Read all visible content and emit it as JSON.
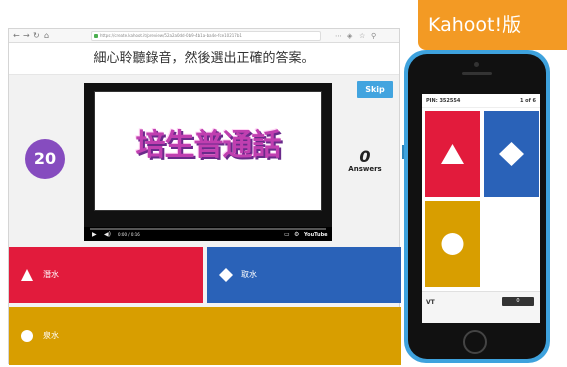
{
  "brand": {
    "label": "Kahoot!版"
  },
  "browser": {
    "url": "https://create.kahoot.it/preview/52a2a0dd-0b9-4b1a-ba4e-fce10217b1"
  },
  "question": {
    "text": "細心聆聽錄音，然後選出正確的答案。"
  },
  "controls": {
    "skip_label": "Skip",
    "timer": "20",
    "answers_count": "0",
    "answers_label": "Answers"
  },
  "video": {
    "title": "培生普通話",
    "time": "0:00 / 0:16",
    "provider": "YouTube"
  },
  "answers": [
    {
      "shape": "triangle-icon",
      "label": "潛水",
      "color": "#e21b3c"
    },
    {
      "shape": "diamond-icon",
      "label": "取水",
      "color": "#2a62b8"
    },
    {
      "shape": "circle-icon",
      "label": "泉水",
      "color": "#d89e00"
    }
  ],
  "phone": {
    "pin": "PIN: 352554",
    "question_progress": "1 of 6",
    "nickname": "VT",
    "score": "0"
  },
  "colors": {
    "timer": "#864cbf",
    "skip": "#42a4df",
    "brand_tag": "#f39a24",
    "phone_body": "#3ea2dd"
  }
}
